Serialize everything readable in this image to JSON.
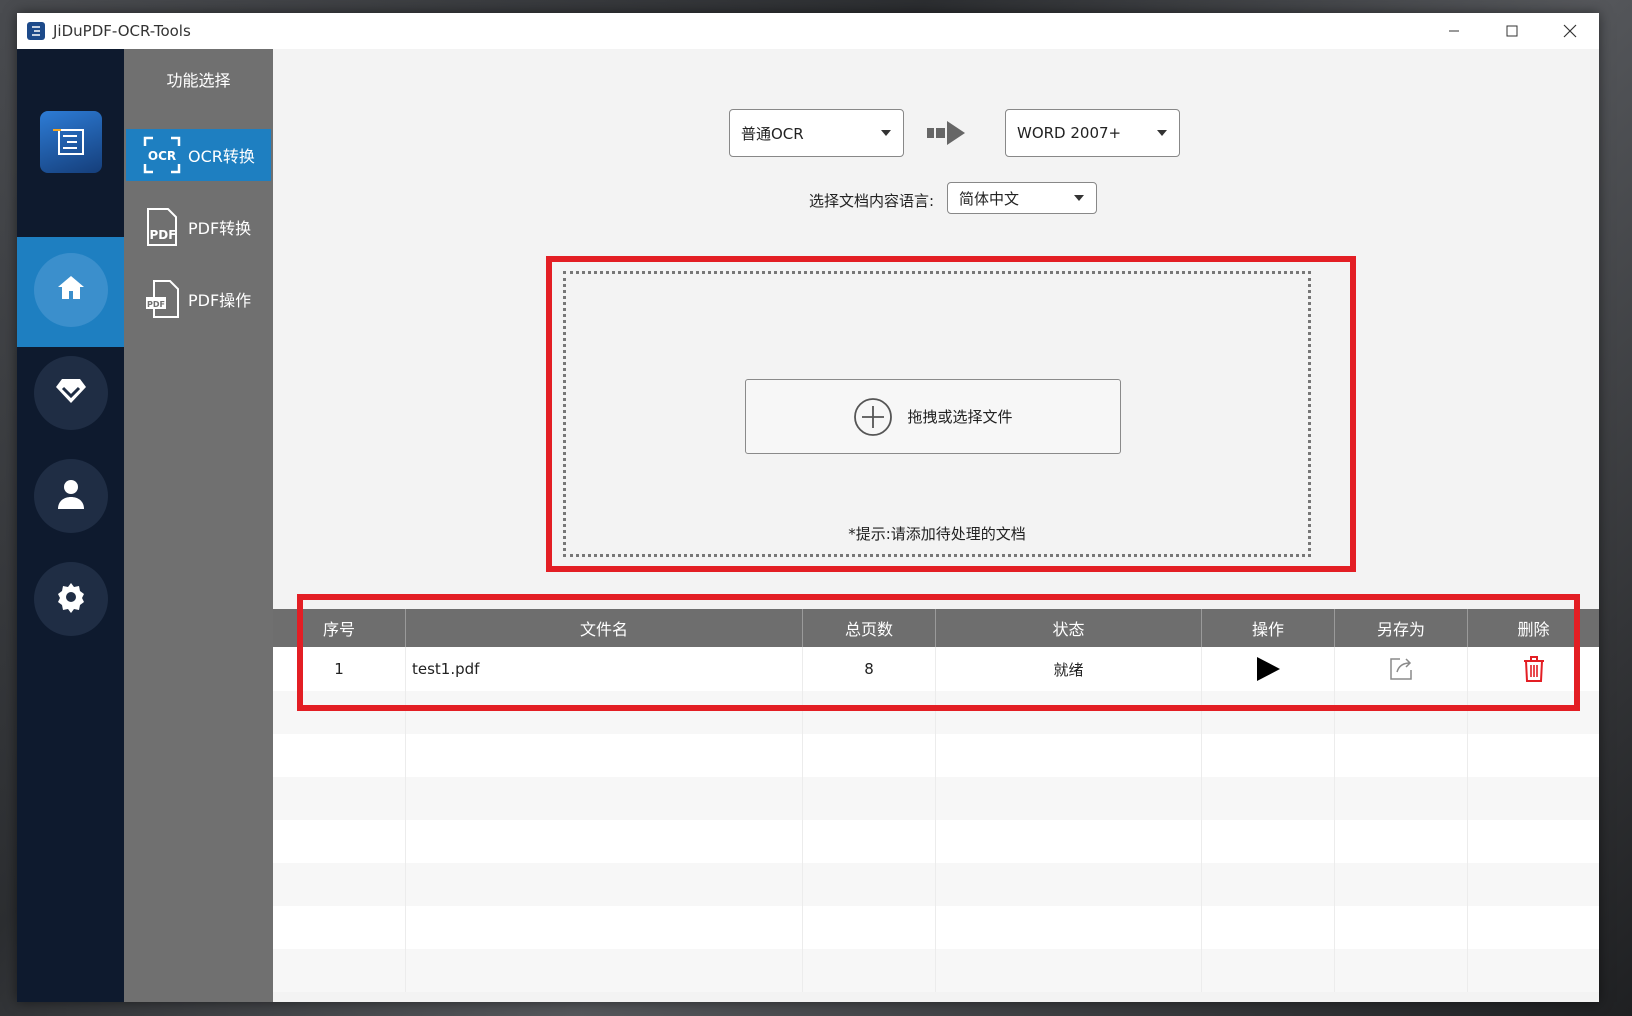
{
  "window": {
    "title": "JiDuPDF-OCR-Tools"
  },
  "func_panel": {
    "title": "功能选择",
    "items": [
      {
        "label": "OCR转换",
        "icon_text": "OCR",
        "active": true
      },
      {
        "label": "PDF转换",
        "icon_text": "PDF",
        "active": false
      },
      {
        "label": "PDF操作",
        "icon_text": "PDF",
        "active": false
      }
    ]
  },
  "conversion": {
    "source_mode": "普通OCR",
    "target_format": "WORD 2007+",
    "language_label": "选择文档内容语言:",
    "language_value": "简体中文"
  },
  "dropzone": {
    "button_label": "拖拽或选择文件",
    "hint": "*提示:请添加待处理的文档"
  },
  "table": {
    "headers": [
      "序号",
      "文件名",
      "总页数",
      "状态",
      "操作",
      "另存为",
      "删除"
    ],
    "rows": [
      {
        "index": "1",
        "filename": "test1.pdf",
        "pages": "8",
        "status": "就绪"
      }
    ]
  },
  "colors": {
    "accent": "#1e7fc1",
    "highlight": "#e31e24",
    "rail": "#0e1a2e",
    "delete": "#e31e24"
  }
}
